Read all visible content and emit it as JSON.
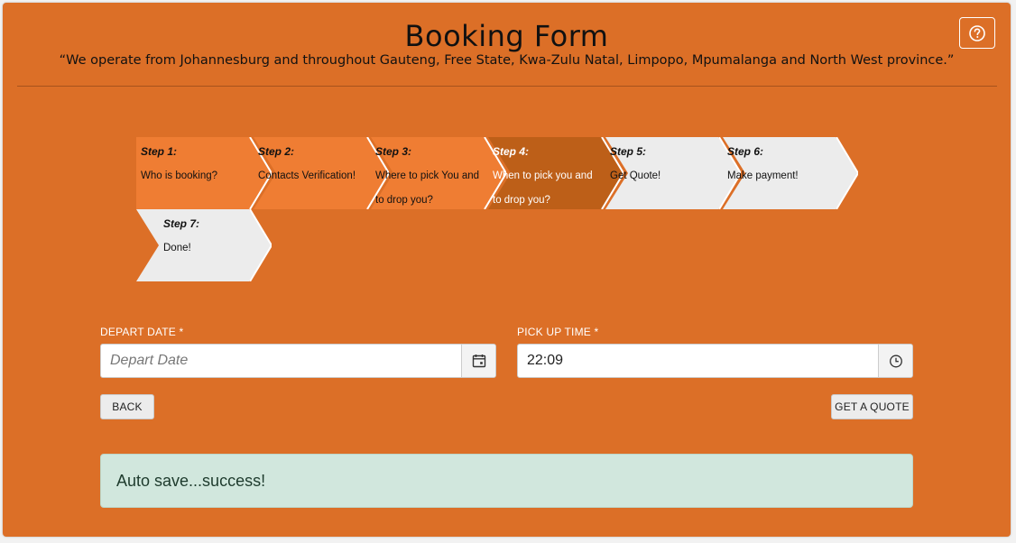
{
  "header": {
    "title": "Booking Form",
    "subtitle": "“We operate from Johannesburg and throughout Gauteng, Free State, Kwa-Zulu Natal, Limpopo, Mpumalanga and North West province.”",
    "help_icon": "question-circle-icon"
  },
  "steps": [
    {
      "title": "Step 1:",
      "desc": "Who is booking?",
      "state": "done"
    },
    {
      "title": "Step 2:",
      "desc": "Contacts Verification!",
      "state": "done"
    },
    {
      "title": "Step 3:",
      "desc": "Where to pick You and to drop you?",
      "state": "done"
    },
    {
      "title": "Step 4:",
      "desc": "When to pick you and to drop you?",
      "state": "current"
    },
    {
      "title": "Step 5:",
      "desc": "Get Quote!",
      "state": "todo"
    },
    {
      "title": "Step 6:",
      "desc": "Make payment!",
      "state": "todo"
    },
    {
      "title": "Step 7:",
      "desc": "Done!",
      "state": "todo"
    }
  ],
  "form": {
    "depart_date": {
      "label": "DEPART DATE *",
      "value": "",
      "placeholder": "Depart Date",
      "icon": "calendar-icon"
    },
    "pickup_time": {
      "label": "PICK UP TIME *",
      "value": "22:09",
      "placeholder": "",
      "icon": "clock-icon"
    }
  },
  "buttons": {
    "back": "BACK",
    "quote": "GET A QUOTE"
  },
  "alert": {
    "text": "Auto save...success!"
  },
  "colors": {
    "panel": "#dc6f27",
    "step_done": "#ef7d33",
    "step_current": "#bd5f18",
    "step_todo": "#ececec",
    "alert_bg": "#d1e7dd"
  }
}
